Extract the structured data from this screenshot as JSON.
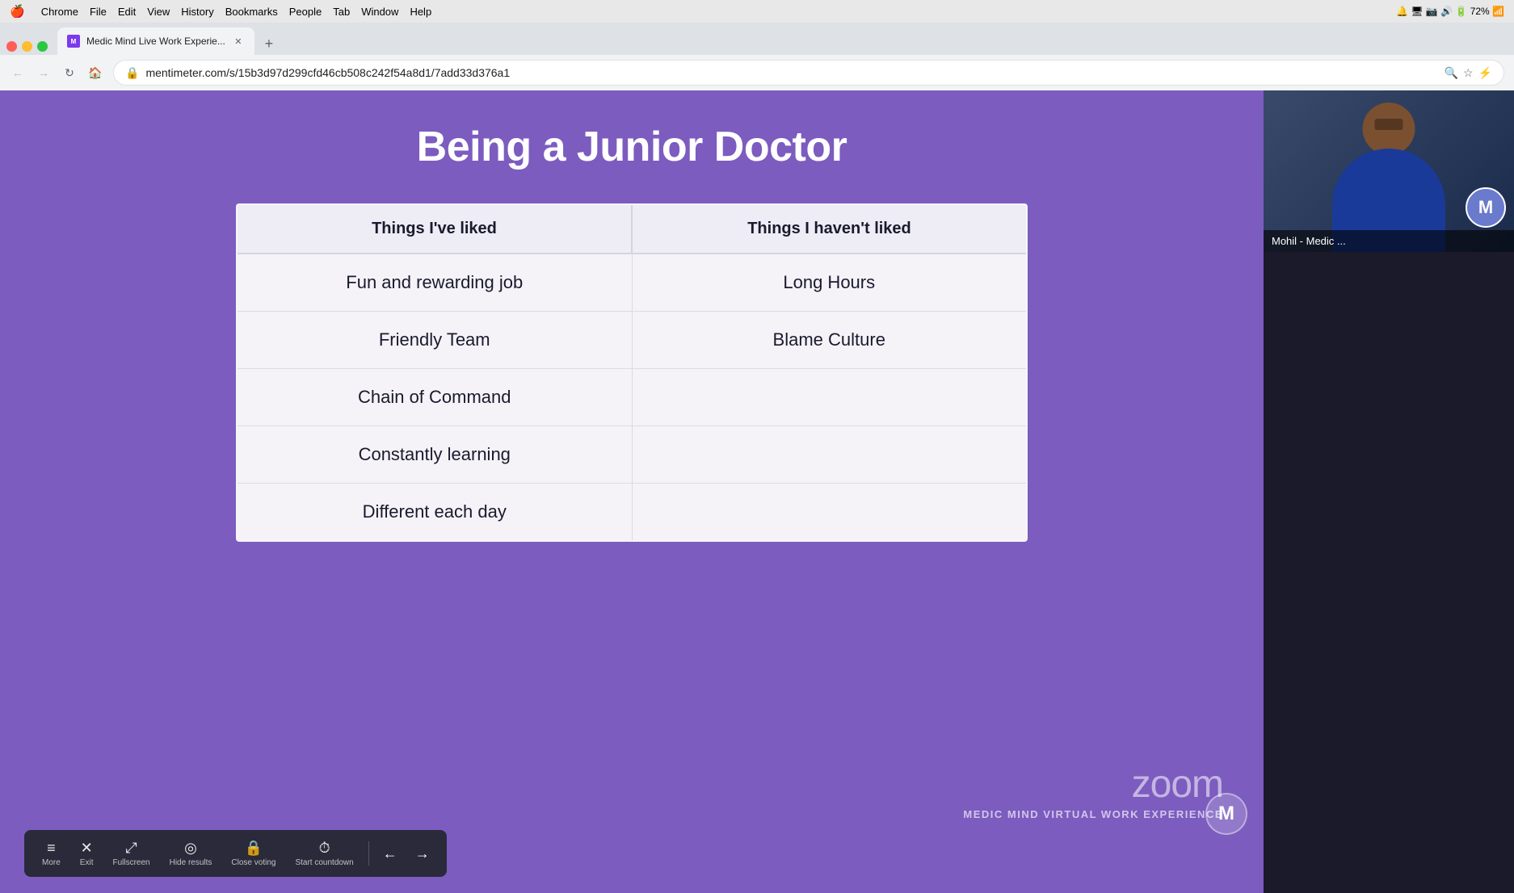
{
  "menubar": {
    "apple": "🍎",
    "items": [
      "Chrome",
      "File",
      "Edit",
      "View",
      "History",
      "Bookmarks",
      "People",
      "Tab",
      "Window",
      "Help"
    ],
    "right_icons": "🔋72% 📶"
  },
  "browser": {
    "tab_title": "Medic Mind Live Work Experie...",
    "url": "mentimeter.com/s/15b3d97d299cfd46cb508c242f54a8d1/7add33d376a1",
    "new_tab_label": "+"
  },
  "slide": {
    "title": "Being a Junior Doctor",
    "col1_header": "Things I've liked",
    "col2_header": "Things I haven't liked",
    "rows": [
      {
        "col1": "Fun and rewarding job",
        "col2": "Long Hours"
      },
      {
        "col1": "Friendly Team",
        "col2": "Blame Culture"
      },
      {
        "col1": "Chain of Command",
        "col2": ""
      },
      {
        "col1": "Constantly learning",
        "col2": ""
      },
      {
        "col1": "Different each day",
        "col2": ""
      }
    ],
    "watermark": "MEDIC MIND VIRTUAL WORK EXPERIENCE",
    "zoom_logo": "zoom"
  },
  "toolbar": {
    "buttons": [
      {
        "icon": "≡",
        "label": "More"
      },
      {
        "icon": "✕",
        "label": "Exit"
      },
      {
        "icon": "⤢",
        "label": "Fullscreen"
      },
      {
        "icon": "◎",
        "label": "Hide results"
      },
      {
        "icon": "🔒",
        "label": "Close voting"
      },
      {
        "icon": "⏱",
        "label": "Start countdown"
      }
    ],
    "nav_prev": "←",
    "nav_next": "→"
  },
  "video": {
    "participant_name": "Mohil - Medic ...",
    "avatar_letter": "M"
  }
}
